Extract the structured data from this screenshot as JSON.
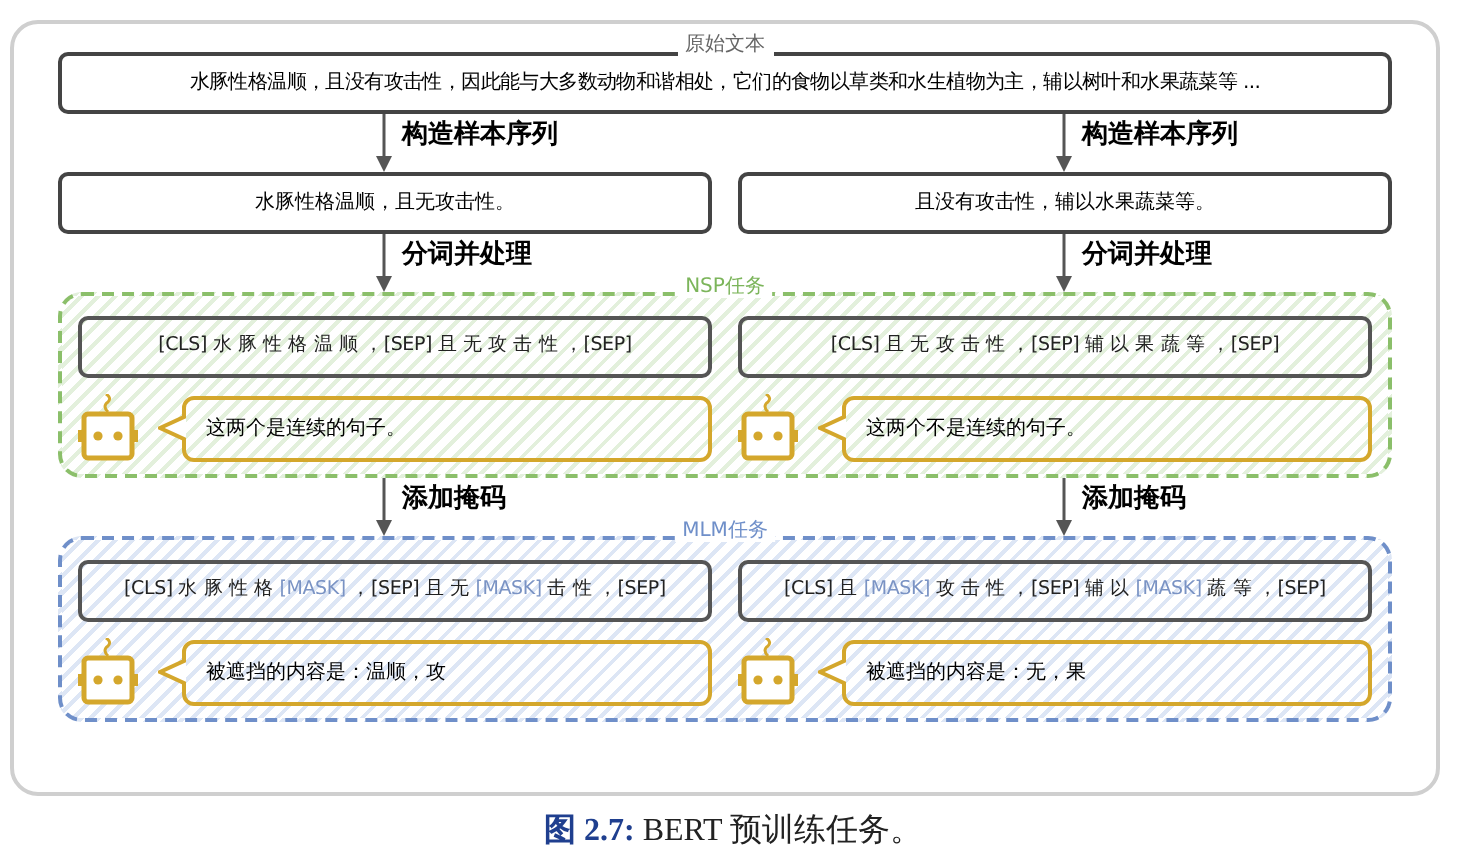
{
  "source": {
    "label": "原始文本",
    "text": "水豚性格温顺，且没有攻击性，因此能与大多数动物和谐相处，它们的食物以草类和水生植物为主，辅以树叶和水果蔬菜等 ..."
  },
  "step1": [
    "构造样本序列",
    "构造样本序列"
  ],
  "samples": [
    "水豚性格温顺，且无攻击性。",
    "且没有攻击性，辅以水果蔬菜等。"
  ],
  "step2": [
    "分词并处理",
    "分词并处理"
  ],
  "nsp": {
    "label": "NSP任务",
    "items": [
      {
        "tokens": [
          {
            "kind": "text",
            "text": "[CLS] 水 豚 性 格 温 顺 ，[SEP] 且 无 攻 击 性 ，[SEP]"
          }
        ],
        "reply": "这两个是连续的句子。"
      },
      {
        "tokens": [
          {
            "kind": "text",
            "text": "[CLS] 且 无 攻 击 性 ，[SEP] 辅 以 果 蔬 等 ，[SEP]"
          }
        ],
        "reply": "这两个不是连续的句子。"
      }
    ]
  },
  "step3": [
    "添加掩码",
    "添加掩码"
  ],
  "mlm": {
    "label": "MLM任务",
    "items": [
      {
        "tokens": [
          {
            "kind": "text",
            "text": "[CLS] 水 豚 性 格 "
          },
          {
            "kind": "mask",
            "text": "[MASK]"
          },
          {
            "kind": "text",
            "text": " ，[SEP] 且 无 "
          },
          {
            "kind": "mask",
            "text": "[MASK]"
          },
          {
            "kind": "text",
            "text": " 击 性 ，[SEP]"
          }
        ],
        "reply": "被遮挡的内容是：温顺，攻"
      },
      {
        "tokens": [
          {
            "kind": "text",
            "text": "[CLS] 且 "
          },
          {
            "kind": "mask",
            "text": "[MASK]"
          },
          {
            "kind": "text",
            "text": " 攻 击 性 ，[SEP] 辅 以 "
          },
          {
            "kind": "mask",
            "text": "[MASK]"
          },
          {
            "kind": "text",
            "text": " 蔬 等 ，[SEP]"
          }
        ],
        "reply": "被遮挡的内容是：无，果"
      }
    ]
  },
  "caption": "**图 2.7:** BERT 预训练任务。"
}
